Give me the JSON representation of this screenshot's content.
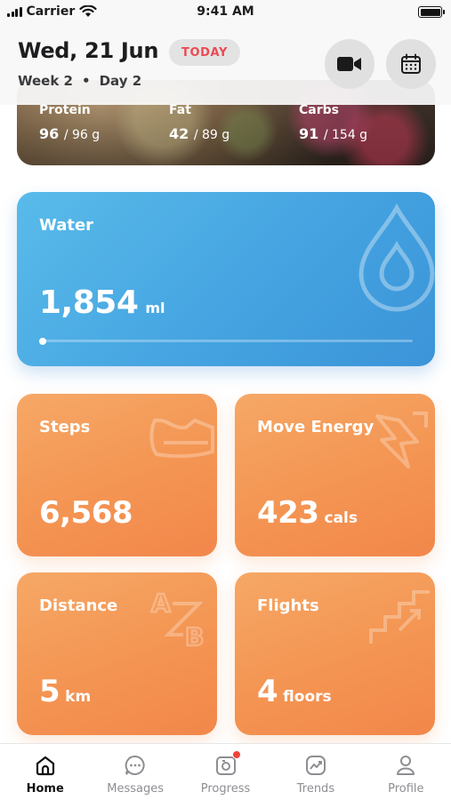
{
  "status_bar": {
    "carrier": "Carrier",
    "time": "9:41 AM",
    "icons": [
      "signal-icon",
      "wifi-icon",
      "battery-icon"
    ]
  },
  "header": {
    "date": "Wed, 21 Jun",
    "today_badge": "TODAY",
    "week": "Week 2",
    "separator": "•",
    "day": "Day 2",
    "video_button_icon": "video-camera-icon",
    "calendar_button_icon": "calendar-icon",
    "accent_color": "#ea4a54"
  },
  "nutrition": {
    "protein": {
      "label": "Protein",
      "value": "96",
      "goal": "/ 96 g"
    },
    "fat": {
      "label": "Fat",
      "value": "42",
      "goal": "/ 89 g"
    },
    "carbs": {
      "label": "Carbs",
      "value": "91",
      "goal": "/ 154 g"
    }
  },
  "water": {
    "title": "Water",
    "value": "1,854",
    "unit": "ml",
    "progress_fraction": 0.0,
    "color": "#45a4e1",
    "icon": "water-drop-icon"
  },
  "stats": {
    "steps": {
      "title": "Steps",
      "value": "6,568",
      "unit": "",
      "icon": "shoe-icon"
    },
    "move_energy": {
      "title": "Move Energy",
      "value": "423",
      "unit": "cals",
      "icon": "lightning-icon"
    },
    "distance": {
      "title": "Distance",
      "value": "5",
      "unit": "km",
      "icon": "a-to-b-icon"
    },
    "flights": {
      "title": "Flights",
      "value": "4",
      "unit": "floors",
      "icon": "stairs-icon"
    },
    "color": "#f49654"
  },
  "tab_bar": {
    "tabs": [
      {
        "label": "Home",
        "icon": "home-icon",
        "active": true
      },
      {
        "label": "Messages",
        "icon": "chat-bubble-icon",
        "active": false
      },
      {
        "label": "Progress",
        "icon": "camera-icon",
        "active": false,
        "badge": true
      },
      {
        "label": "Trends",
        "icon": "trend-chart-icon",
        "active": false
      },
      {
        "label": "Profile",
        "icon": "person-icon",
        "active": false
      }
    ]
  }
}
